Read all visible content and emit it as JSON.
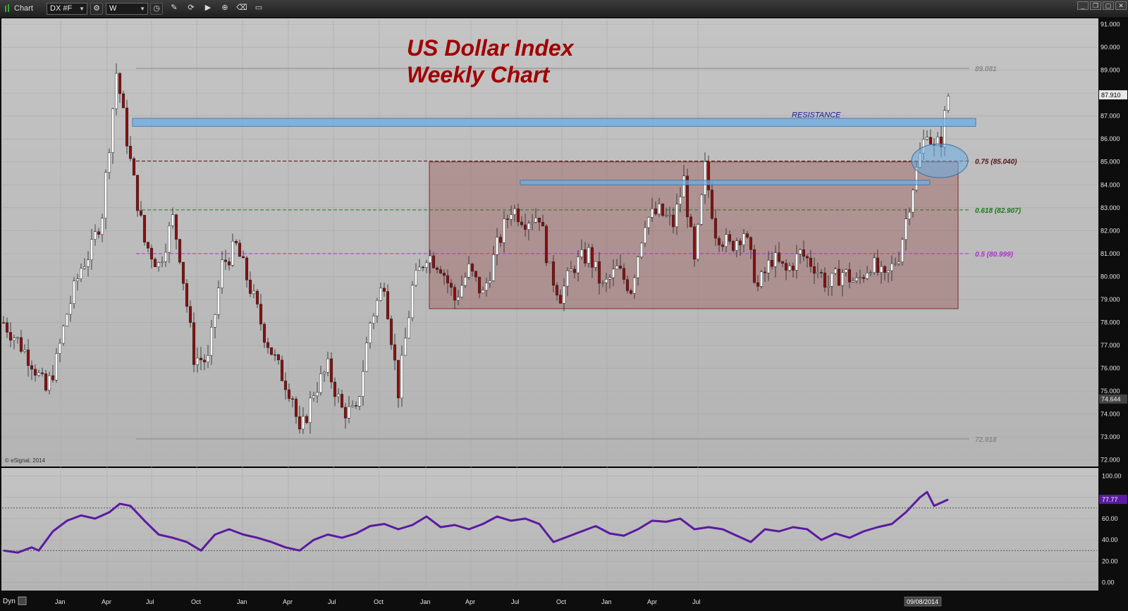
{
  "window": {
    "title": "Chart",
    "symbol": "DX #F",
    "interval": "W",
    "toolbar_icons": [
      "settings-icon",
      "clock-icon",
      "pencil-icon",
      "refresh-icon",
      "play-icon",
      "zoom-icon",
      "eraser-icon",
      "window-icon"
    ],
    "window_buttons": [
      "minimize",
      "restore",
      "restore-down",
      "close"
    ]
  },
  "colors": {
    "background": "#b9b9b9",
    "up_candle": "#ffffff",
    "down_candle": "#8b0f0f",
    "range_box": "rgba(150,70,70,0.35)",
    "resistance_band": "#6aaee6",
    "indicator_line": "#5b1aa0",
    "title": "#a00000"
  },
  "chart_data": {
    "type": "candlestick",
    "title": "US Dollar Index",
    "subtitle": "Weekly Chart",
    "watermark": "© eSignal, 2014",
    "yticks_main": [
      "91.000",
      "90.000",
      "89.000",
      "88.000",
      "87.000",
      "86.000",
      "85.000",
      "84.000",
      "83.000",
      "82.000",
      "81.000",
      "80.000",
      "79.000",
      "78.000",
      "77.000",
      "76.000",
      "75.000",
      "74.000",
      "73.000",
      "72.000"
    ],
    "ylim_main": [
      71.9,
      91.2
    ],
    "last_price": "87.910",
    "last_price_value": 87.91,
    "other_price_tag": "74.644",
    "other_price_value": 74.644,
    "xticks": [
      "Jan",
      "Apr",
      "Jul",
      "Oct",
      "Jan",
      "Apr",
      "Jul",
      "Oct",
      "Jan",
      "Apr",
      "Jul",
      "Oct",
      "Jan",
      "Apr",
      "Jul"
    ],
    "date_badge": "09/08/2014",
    "levels": [
      {
        "label": "89.081",
        "value": 89.081,
        "style": "solid",
        "color": "#888888"
      },
      {
        "label": "0.75 (85.040)",
        "value": 85.04,
        "style": "dashed",
        "color": "#5a1515"
      },
      {
        "label": "0.618 (82.907)",
        "value": 82.907,
        "style": "dashed",
        "color": "#1a7a1a"
      },
      {
        "label": "0.5 (80.999)",
        "value": 80.999,
        "style": "dashed",
        "color": "#b030d0"
      },
      {
        "label": "72.918",
        "value": 72.918,
        "style": "solid",
        "color": "#888888"
      }
    ],
    "annotations": {
      "resistance_label": "RESISTANCE",
      "resistance_band": [
        86.55,
        86.9
      ],
      "inner_band": [
        84.0,
        84.2
      ],
      "range_box": {
        "low": 78.6,
        "high": 85.0
      }
    },
    "price_path": [
      [
        0,
        78.0
      ],
      [
        4,
        77.2
      ],
      [
        8,
        76.3
      ],
      [
        12,
        75.0
      ],
      [
        15,
        76.3
      ],
      [
        18,
        78.4
      ],
      [
        22,
        80.4
      ],
      [
        25,
        81.2
      ],
      [
        28,
        82.8
      ],
      [
        32,
        88.9
      ],
      [
        33,
        88.0
      ],
      [
        36,
        85.0
      ],
      [
        40,
        81.5
      ],
      [
        44,
        80.5
      ],
      [
        48,
        82.5
      ],
      [
        50,
        81.0
      ],
      [
        54,
        76.5
      ],
      [
        58,
        76.3
      ],
      [
        62,
        80.5
      ],
      [
        66,
        81.3
      ],
      [
        70,
        79.5
      ],
      [
        74,
        77.5
      ],
      [
        78,
        76.0
      ],
      [
        82,
        74.8
      ],
      [
        84,
        73.0
      ],
      [
        88,
        75.0
      ],
      [
        92,
        76.0
      ],
      [
        96,
        74.2
      ],
      [
        100,
        74.0
      ],
      [
        104,
        78.0
      ],
      [
        108,
        79.8
      ],
      [
        112,
        75.0
      ],
      [
        116,
        79.5
      ],
      [
        120,
        81.0
      ],
      [
        124,
        80.5
      ],
      [
        128,
        79.0
      ],
      [
        132,
        80.3
      ],
      [
        136,
        79.2
      ],
      [
        140,
        81.3
      ],
      [
        144,
        83.0
      ],
      [
        148,
        82.5
      ],
      [
        152,
        82.7
      ],
      [
        155,
        80.2
      ],
      [
        158,
        79.2
      ],
      [
        162,
        80.5
      ],
      [
        166,
        81.0
      ],
      [
        170,
        79.5
      ],
      [
        174,
        80.3
      ],
      [
        178,
        79.5
      ],
      [
        182,
        82.5
      ],
      [
        186,
        82.8
      ],
      [
        190,
        82.3
      ],
      [
        193,
        84.2
      ],
      [
        196,
        80.5
      ],
      [
        199,
        84.7
      ],
      [
        202,
        82.0
      ],
      [
        206,
        81.3
      ],
      [
        210,
        82.0
      ],
      [
        214,
        79.5
      ],
      [
        218,
        80.8
      ],
      [
        222,
        80.2
      ],
      [
        226,
        81.0
      ],
      [
        230,
        80.5
      ],
      [
        234,
        79.6
      ],
      [
        238,
        80.2
      ],
      [
        242,
        79.7
      ],
      [
        246,
        80.6
      ],
      [
        250,
        79.8
      ],
      [
        254,
        81.0
      ],
      [
        258,
        84.0
      ],
      [
        262,
        86.5
      ],
      [
        264,
        85.5
      ],
      [
        266,
        86.0
      ],
      [
        268,
        87.91
      ]
    ],
    "indicator": {
      "yticks": [
        "100.00",
        "80.00",
        "60.00",
        "40.00",
        "20.00",
        "0.00"
      ],
      "ylim": [
        -5,
        105
      ],
      "levels": [
        70,
        30
      ],
      "last_value": "77.77",
      "last_value_num": 77.77,
      "secondary_tag": "",
      "values": [
        [
          0,
          30
        ],
        [
          4,
          28
        ],
        [
          8,
          33
        ],
        [
          10,
          30
        ],
        [
          14,
          48
        ],
        [
          18,
          58
        ],
        [
          22,
          63
        ],
        [
          26,
          60
        ],
        [
          30,
          66
        ],
        [
          33,
          74
        ],
        [
          36,
          72
        ],
        [
          40,
          58
        ],
        [
          44,
          45
        ],
        [
          48,
          42
        ],
        [
          52,
          38
        ],
        [
          56,
          30
        ],
        [
          60,
          45
        ],
        [
          64,
          50
        ],
        [
          68,
          45
        ],
        [
          72,
          42
        ],
        [
          76,
          38
        ],
        [
          80,
          33
        ],
        [
          84,
          30
        ],
        [
          88,
          40
        ],
        [
          92,
          45
        ],
        [
          96,
          42
        ],
        [
          100,
          46
        ],
        [
          104,
          53
        ],
        [
          108,
          55
        ],
        [
          112,
          50
        ],
        [
          116,
          54
        ],
        [
          120,
          62
        ],
        [
          124,
          52
        ],
        [
          128,
          54
        ],
        [
          132,
          50
        ],
        [
          136,
          55
        ],
        [
          140,
          62
        ],
        [
          144,
          58
        ],
        [
          148,
          60
        ],
        [
          152,
          55
        ],
        [
          156,
          38
        ],
        [
          160,
          43
        ],
        [
          164,
          48
        ],
        [
          168,
          53
        ],
        [
          172,
          46
        ],
        [
          176,
          44
        ],
        [
          180,
          50
        ],
        [
          184,
          58
        ],
        [
          188,
          57
        ],
        [
          192,
          60
        ],
        [
          196,
          50
        ],
        [
          200,
          52
        ],
        [
          204,
          50
        ],
        [
          208,
          44
        ],
        [
          212,
          38
        ],
        [
          216,
          50
        ],
        [
          220,
          48
        ],
        [
          224,
          52
        ],
        [
          228,
          50
        ],
        [
          232,
          40
        ],
        [
          236,
          46
        ],
        [
          240,
          42
        ],
        [
          244,
          48
        ],
        [
          248,
          52
        ],
        [
          252,
          55
        ],
        [
          256,
          66
        ],
        [
          260,
          80
        ],
        [
          262,
          85
        ],
        [
          264,
          72
        ],
        [
          268,
          78
        ]
      ]
    }
  }
}
